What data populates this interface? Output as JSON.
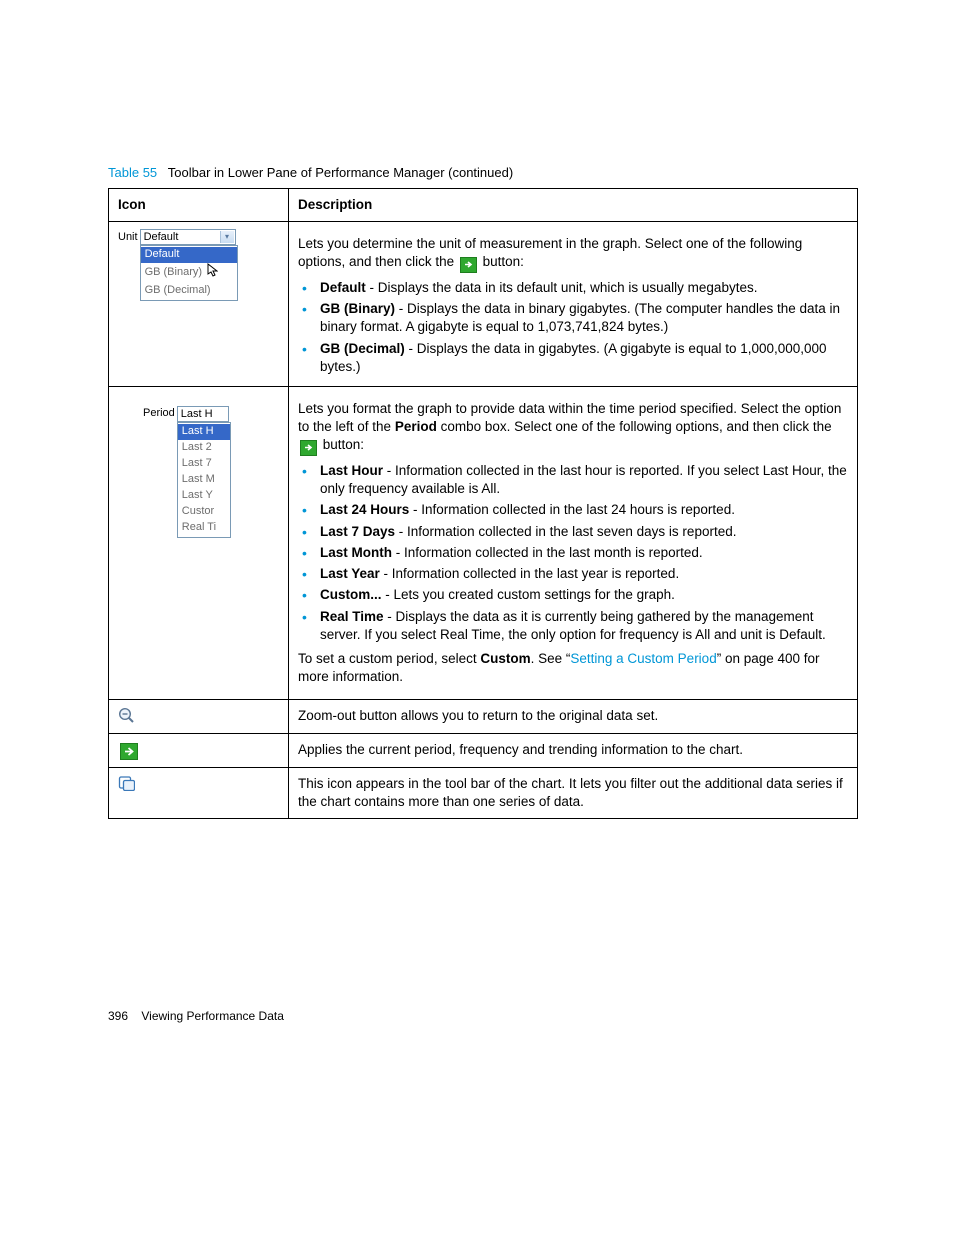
{
  "caption": {
    "label": "Table 55",
    "title": "Toolbar in Lower Pane of Performance Manager (continued)"
  },
  "headers": {
    "icon": "Icon",
    "desc": "Description"
  },
  "unit": {
    "label": "Unit",
    "selected": "Default",
    "options": [
      "Default",
      "GB (Binary)",
      "GB (Decimal)"
    ],
    "desc_intro_a": "Lets you determine the unit of measurement in the graph. Select one of the following options, and then click the ",
    "desc_intro_b": " button:",
    "items": [
      {
        "term": "Default",
        "text": " - Displays the data in its default unit, which is usually megabytes."
      },
      {
        "term": "GB (Binary)",
        "text": " - Displays the data in binary gigabytes. (The computer handles the data in binary format. A gigabyte is equal to 1,073,741,824 bytes.)"
      },
      {
        "term": "GB (Decimal)",
        "text": " - Displays the data in gigabytes. (A gigabyte is equal to 1,000,000,000 bytes.)"
      }
    ]
  },
  "period": {
    "label": "Period",
    "selected": "Last H",
    "options": [
      "Last H",
      "Last 2",
      "Last 7",
      "Last M",
      "Last Y",
      "Custor",
      "Real Ti"
    ],
    "desc_a": "Lets you format the graph to provide data within the time period specified. Select the option to the left of the ",
    "desc_bold": "Period",
    "desc_b": " combo box. Select one of the following options, and then click the ",
    "desc_c": " button:",
    "items": [
      {
        "term": "Last Hour",
        "text": " - Information collected in the last hour is reported. If you select Last Hour, the only frequency available is All."
      },
      {
        "term": "Last 24 Hours",
        "text": " - Information collected in the last 24 hours is reported."
      },
      {
        "term": "Last 7 Days",
        "text": " - Information collected in the last seven days is reported."
      },
      {
        "term": "Last Month",
        "text": " - Information collected in the last month is reported."
      },
      {
        "term": "Last Year",
        "text": " - Information collected in the last year is reported."
      },
      {
        "term": "Custom...",
        "text": " - Lets you created custom settings for the graph."
      },
      {
        "term": "Real Time",
        "text": " - Displays the data as it is currently being gathered by the management server. If you select Real Time, the only option for frequency is All and unit is Default."
      }
    ],
    "custom_a": "To set a custom period, select ",
    "custom_bold": "Custom",
    "custom_b": ". See “",
    "custom_link": "Setting a Custom Period",
    "custom_c": "” on page 400 for more information."
  },
  "zoomout": {
    "text": "Zoom-out button allows you to return to the original data set."
  },
  "apply": {
    "text": "Applies the current period, frequency and trending information to the chart."
  },
  "filter": {
    "text": "This icon appears in the tool bar of the chart. It lets you filter out the additional data series if the chart contains more than one series of data."
  },
  "footer": {
    "page": "396",
    "title": "Viewing Performance Data"
  }
}
